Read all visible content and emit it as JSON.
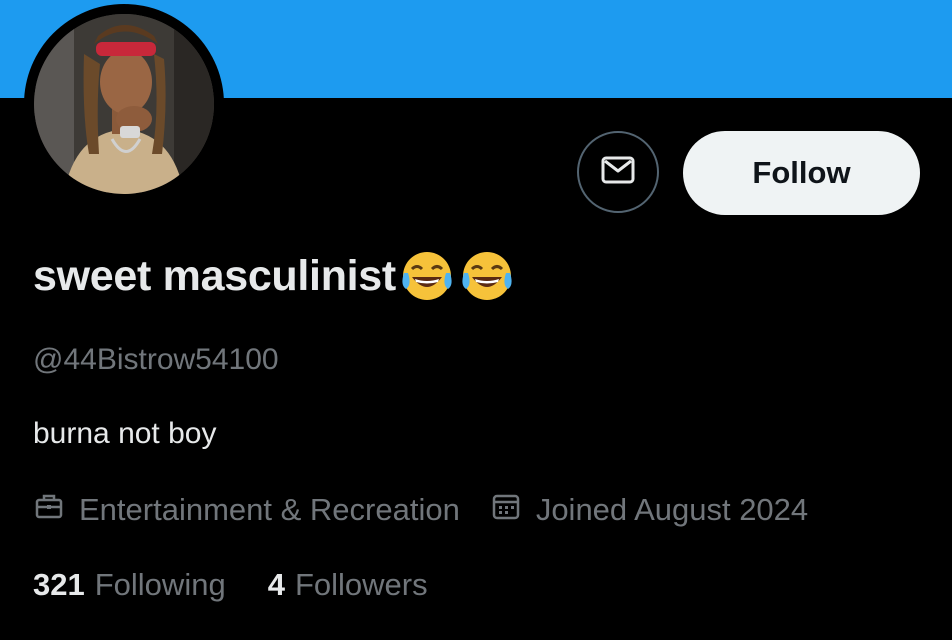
{
  "header": {
    "banner_color": "#1d9bf0"
  },
  "profile": {
    "avatar_alt": "profile photo",
    "display_name": "sweet masculinist",
    "name_emojis": [
      "face-with-tears-of-joy",
      "face-with-tears-of-joy"
    ],
    "handle": "@44Bistrow54100",
    "bio": "burna not boy",
    "category": "Entertainment & Recreation",
    "joined": "Joined August 2024"
  },
  "actions": {
    "message_icon": "envelope-icon",
    "follow_label": "Follow"
  },
  "stats": {
    "following_count": "321",
    "following_label": "Following",
    "followers_count": "4",
    "followers_label": "Followers"
  },
  "colors": {
    "background": "#000000",
    "text_primary": "#e7e9ea",
    "text_secondary": "#71767b",
    "follow_button_bg": "#eff3f4",
    "accent": "#1d9bf0"
  }
}
